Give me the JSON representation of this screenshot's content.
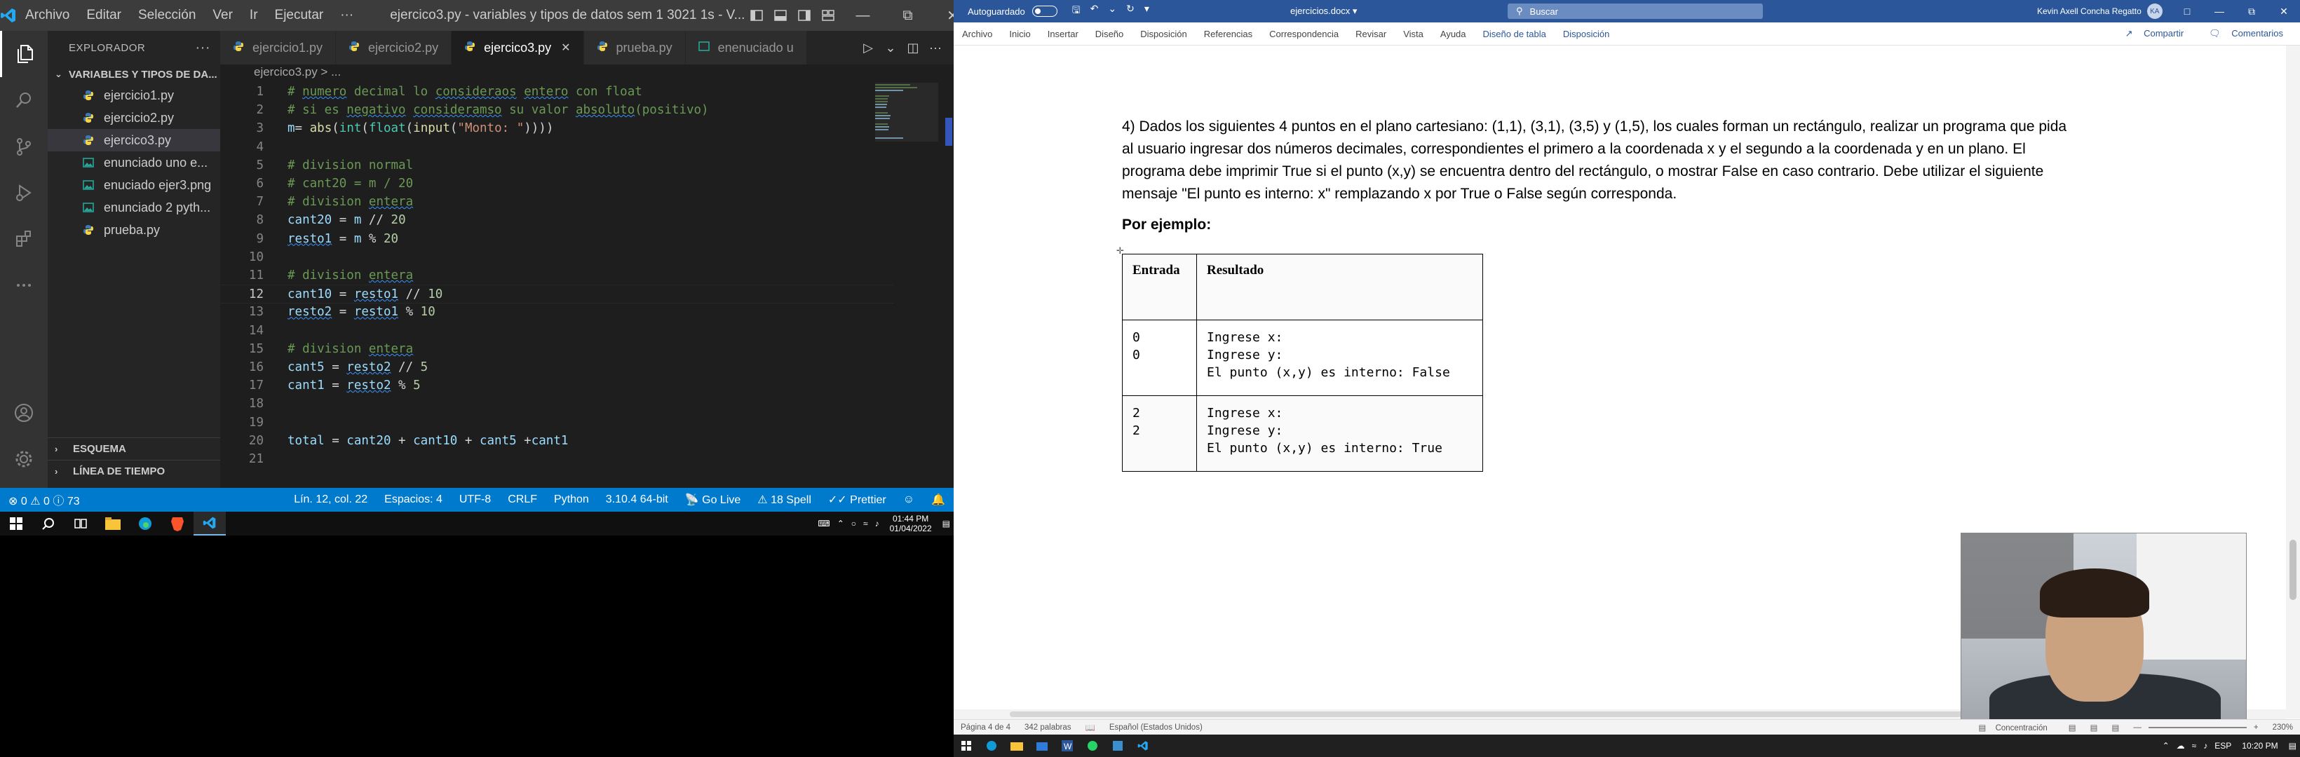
{
  "vscode": {
    "menu": [
      "Archivo",
      "Editar",
      "Selección",
      "Ver",
      "Ir",
      "Ejecutar",
      "···"
    ],
    "window_title": "ejercico3.py - variables y tipos de datos sem 1 3021 1s - V...",
    "explorer_title": "EXPLORADOR",
    "explorer_more": "···",
    "folder_name": "VARIABLES Y TIPOS DE DA...",
    "files": [
      {
        "name": "ejercicio1.py",
        "kind": "python"
      },
      {
        "name": "ejercicio2.py",
        "kind": "python"
      },
      {
        "name": "ejercico3.py",
        "kind": "python"
      },
      {
        "name": "enunciado uno e...",
        "kind": "image"
      },
      {
        "name": "enuciado ejer3.png",
        "kind": "image"
      },
      {
        "name": "enunciado 2 pyth...",
        "kind": "image"
      },
      {
        "name": "prueba.py",
        "kind": "python"
      }
    ],
    "outline_sections": [
      "ESQUEMA",
      "LÍNEA DE TIEMPO"
    ],
    "tabs": [
      {
        "label": "ejercicio1.py",
        "active": false
      },
      {
        "label": "ejercicio2.py",
        "active": false
      },
      {
        "label": "ejercico3.py",
        "active": true
      },
      {
        "label": "prueba.py",
        "active": false
      },
      {
        "label": "enenuciado u",
        "active": false
      }
    ],
    "breadcrumb": "ejercico3.py > ...",
    "code_lines": [
      {
        "n": "1",
        "text": "# numero decimal lo consideraos entero con float"
      },
      {
        "n": "2",
        "text": "# si es negativo consideramso su valor absoluto(positivo)"
      },
      {
        "n": "3",
        "text": "m= abs(int(float(input(\"Monto: \"))))"
      },
      {
        "n": "4",
        "text": ""
      },
      {
        "n": "5",
        "text": "# division normal"
      },
      {
        "n": "6",
        "text": "# cant20 = m / 20"
      },
      {
        "n": "7",
        "text": "# division entera"
      },
      {
        "n": "8",
        "text": "cant20 = m // 20"
      },
      {
        "n": "9",
        "text": "resto1 = m % 20"
      },
      {
        "n": "10",
        "text": ""
      },
      {
        "n": "11",
        "text": "# division entera"
      },
      {
        "n": "12",
        "text": "cant10 = resto1 // 10"
      },
      {
        "n": "13",
        "text": "resto2 = resto1 % 10"
      },
      {
        "n": "14",
        "text": ""
      },
      {
        "n": "15",
        "text": "# division entera"
      },
      {
        "n": "16",
        "text": "cant5 = resto2 // 5"
      },
      {
        "n": "17",
        "text": "cant1 = resto2 % 5"
      },
      {
        "n": "18",
        "text": ""
      },
      {
        "n": "19",
        "text": ""
      },
      {
        "n": "20",
        "text": "total = cant20 + cant10 + cant5 +cant1"
      },
      {
        "n": "21",
        "text": ""
      }
    ],
    "status_left": {
      "errors": "0",
      "warnings": "0",
      "info": "73"
    },
    "status_right": [
      "Lín. 12, col. 22",
      "Espacios: 4",
      "UTF-8",
      "CRLF",
      "Python",
      "3.10.4 64-bit",
      "Go Live",
      "18 Spell",
      "Prettier"
    ],
    "colors": {
      "status_bar": "#007acc",
      "titlebar": "#3c3c3c",
      "sidebar": "#252526",
      "editor": "#1e1e1e"
    }
  },
  "taskbar_left": {
    "time": "01:44 PM",
    "date": "01/04/2022"
  },
  "word": {
    "autosave_label": "Autoguardado",
    "doc_title": "ejercicios.docx",
    "search_placeholder": "Buscar",
    "user_name": "Kevin Axell Concha Regatto",
    "user_initials": "KA",
    "ribbon_tabs": [
      "Archivo",
      "Inicio",
      "Insertar",
      "Diseño",
      "Disposición",
      "Referencias",
      "Correspondencia",
      "Revisar",
      "Vista",
      "Ayuda",
      "Diseño de tabla",
      "Disposición"
    ],
    "share_label": "Compartir",
    "comments_label": "Comentarios",
    "paragraph": "4) Dados los siguientes 4 puntos en el plano cartesiano: (1,1), (3,1), (3,5) y (1,5), los cuales forman un rectángulo, realizar un programa que pida al usuario ingresar dos números decimales, correspondientes el primero a la coordenada x y el segundo a la coordenada y en un plano. El programa debe imprimir True si el punto (x,y) se encuentra dentro del rectángulo, o mostrar False en caso contrario.  Debe utilizar el siguiente mensaje \"El punto es interno: x\" remplazando x por True o False según corresponda.",
    "example_heading": "Por ejemplo:",
    "table": {
      "headers": [
        "Entrada",
        "Resultado"
      ],
      "rows": [
        {
          "input": "0\n0",
          "output": "Ingrese x:\nIngrese y:\nEl punto (x,y) es interno: False"
        },
        {
          "input": "2\n2",
          "output": "Ingrese x:\nIngrese y:\nEl punto (x,y) es interno: True"
        }
      ]
    },
    "status": {
      "page": "Página 4 de 4",
      "words": "342 palabras",
      "language": "Español (Estados Unidos)",
      "focus": "Concentración",
      "zoom": "230%"
    },
    "colors": {
      "titlebar": "#2b579a"
    }
  },
  "taskbar_right": {
    "lang": "ESP",
    "time": "10:20 PM"
  }
}
